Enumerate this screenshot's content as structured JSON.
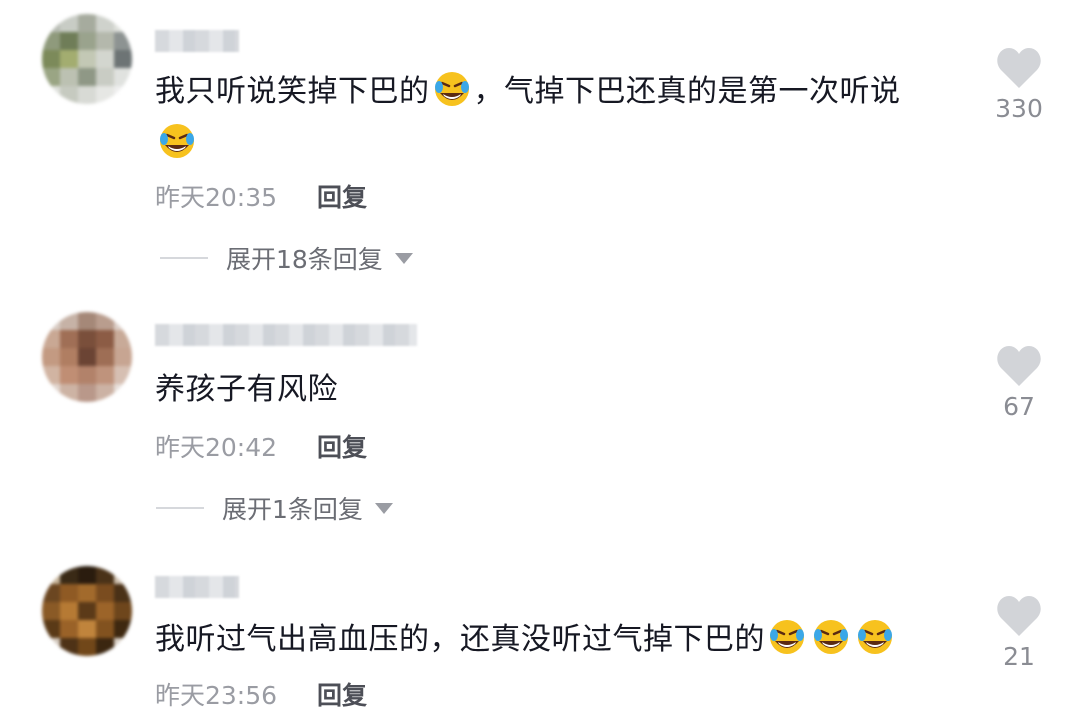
{
  "comments": [
    {
      "text_parts": [
        "我只听说笑掉下巴的",
        "，气掉下巴还真的是第一次听说"
      ],
      "emoji": "rofl-emoji",
      "time": "昨天20:35",
      "reply_label": "回复",
      "expand_label": "展开18条回复",
      "likes": "330"
    },
    {
      "text_parts": [
        "养孩子有风险"
      ],
      "time": "昨天20:42",
      "reply_label": "回复",
      "expand_label": "展开1条回复",
      "likes": "67"
    },
    {
      "text_parts": [
        "我听过气出高血压的，还真没听过气掉下巴的"
      ],
      "emoji": "rofl-emoji",
      "time": "昨天23:56",
      "reply_label": "回复",
      "likes": "21"
    }
  ],
  "colors": {
    "text": "#161823",
    "meta": "#9a9ca3",
    "heart": "#d2d4d8"
  },
  "icons": {
    "like": "heart-icon",
    "expand": "caret-down-icon"
  }
}
